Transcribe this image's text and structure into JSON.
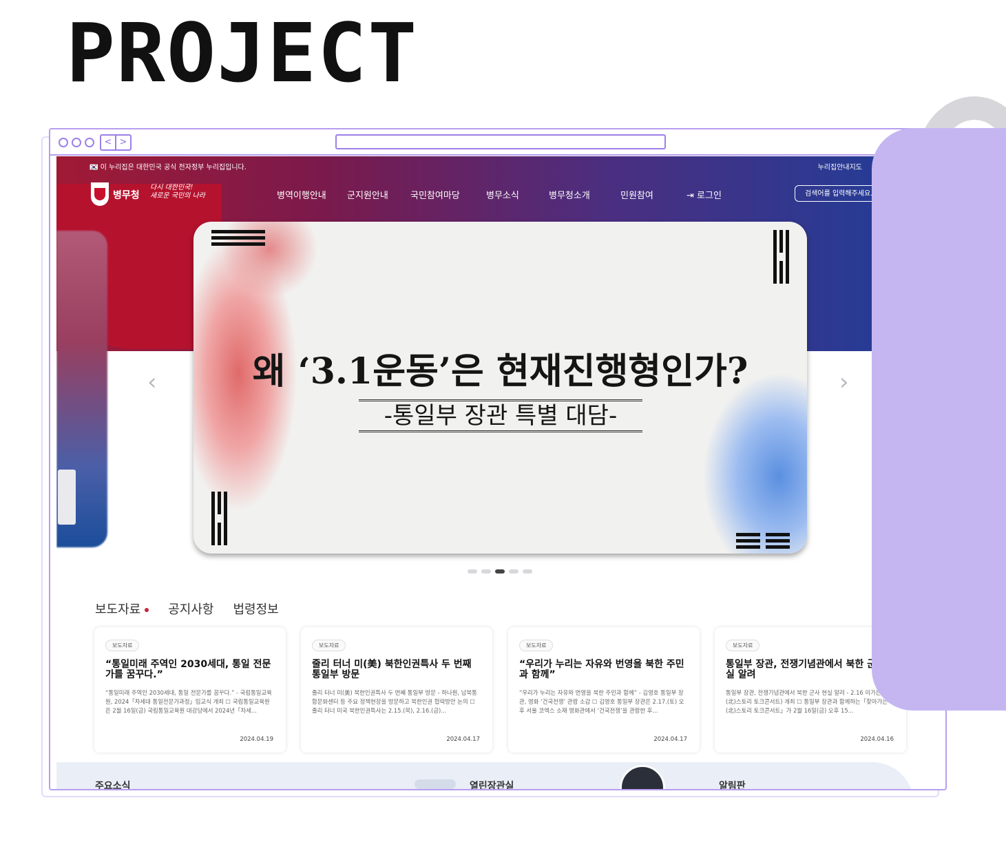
{
  "page_title": "PROJECT",
  "website": {
    "notice": "🇰🇷 이 누리집은 대한민국 공식 전자정부 누리집입니다.",
    "notice_right": "누리집안내지도",
    "logo_text": "병무청",
    "slogan_line1": "다시 대한민국!",
    "slogan_line2": "새로운 국민의 나라",
    "menu": [
      "병역이행안내",
      "군지원안내",
      "국민참여마당",
      "병무소식",
      "병무청소개",
      "민원참여"
    ],
    "login": "⇥ 로그인",
    "search_placeholder": "검색어를 입력해주세요."
  },
  "slide": {
    "heading": "왜 ‘3.1운동’은 현재진행형인가?",
    "subheading": "-통일부 장관 특별 대담-",
    "prev_arrow": "‹",
    "next_arrow": "›",
    "active_index": 2,
    "total": 5
  },
  "tabs": [
    "보도자료",
    "공지사항",
    "법령정보"
  ],
  "cards": [
    {
      "badge": "보도자료",
      "title": "“통일미래 주역인 2030세대, 통일 전문가를 꿈꾸다.”",
      "body": "“통일미래 주역인 2030세대, 통일 전문가를 꿈꾸다.” - 국립통일교육원, 2024「차세대 통일전문가과정」입교식 개최 ☐ 국립통일교육원은 2월 16일(금) 국립통일교육원 대강당에서 2024년「차세...",
      "date": "2024.04.19"
    },
    {
      "badge": "보도자료",
      "title": "줄리 터너 미(美) 북한인권특사 두 번째 통일부 방문",
      "body": "줄리 터너 미(美) 북한인권특사 두 번째 통일부 방문 - 하나원, 남북통합문화센터 등 주요 정책현장을 방문하고 북한인권 협력방안 논의 ☐ 줄리 터너 미국 북한인권특사는 2.15.(목), 2.16.(금)...",
      "date": "2024.04.17"
    },
    {
      "badge": "보도자료",
      "title": "“우리가 누리는 자유와 번영을 북한 주민과 함께”",
      "body": "“우리가 누리는 자유와 번영을 북한 주민과 함께” - 김영호 통일부 장관, 영화 ‘건국전쟁’ 관람 소감 ☐ 김영호 통일부 장관은 2.17.(토) 오후 서울 코엑스 소재 영화관에서 ‘건국전쟁’을 관람한 후...",
      "date": "2024.04.17"
    },
    {
      "badge": "보도자료",
      "title": "통일부 장관, 전쟁기념관에서 북한 군 현실 알려",
      "body": "통일부 장관, 전쟁기념관에서 북한 군사 현실 알려 - 2.16 이가는 북(北)스토리 토크콘서트) 개최 ☐ 통일부 장관과 함께하는「찾아가는 북(北)스토리 토크콘서트」가 2월 16일(금) 오후 15...",
      "date": "2024.04.16"
    }
  ],
  "bottom": [
    "주요소식",
    "열린장관실",
    "알림판"
  ],
  "colors": {
    "accent_purple": "#b79df0",
    "panel_purple": "#c5b6f2",
    "hero_red": "#a01a35",
    "hero_blue": "#1d3f9a",
    "tab_dot": "#c8233c"
  }
}
